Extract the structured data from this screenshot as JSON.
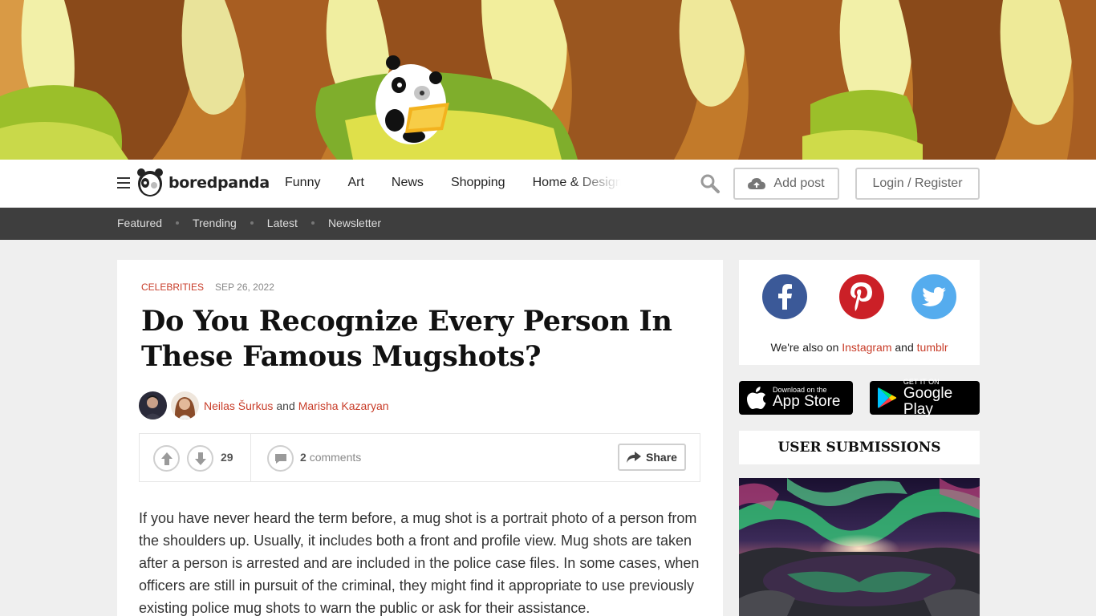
{
  "nav": {
    "logo_text": "boredpanda",
    "items": [
      "Funny",
      "Art",
      "News",
      "Shopping",
      "Home & Design"
    ],
    "add_post": "Add post",
    "login": "Login / Register"
  },
  "subnav": {
    "items": [
      "Featured",
      "Trending",
      "Latest",
      "Newsletter"
    ]
  },
  "article": {
    "category": "CELEBRITIES",
    "date": "SEP 26, 2022",
    "title": "Do You Recognize Every Person In These Famous Mugshots?",
    "author1": "Neilas Šurkus",
    "and": "and",
    "author2": "Marisha Kazaryan",
    "votes": "29",
    "comments_count": "2",
    "comments_label": "comments",
    "share": "Share",
    "body": "If you have never heard the term before, a mug shot is a portrait photo of a person from the shoulders up. Usually, it includes both a front and profile view. Mug shots are taken after a person is arrested and are included in the police case files. In some cases, when officers are still in pursuit of the criminal, they might find it appropriate to use previously existing police mug shots to warn the public or ask for their assistance."
  },
  "sidebar": {
    "social_prefix": "We're also on",
    "instagram": "Instagram",
    "and": "and",
    "tumblr": "tumblr",
    "appstore_small": "Download on the",
    "appstore_big": "App Store",
    "googleplay_small": "GET IT ON",
    "googleplay_big": "Google Play",
    "user_submissions": "USER SUBMISSIONS"
  },
  "colors": {
    "accent": "#c83c28",
    "facebook": "#3b5998",
    "pinterest": "#cb2027",
    "twitter": "#55acee",
    "subnav_bg": "#3e3e3e"
  }
}
